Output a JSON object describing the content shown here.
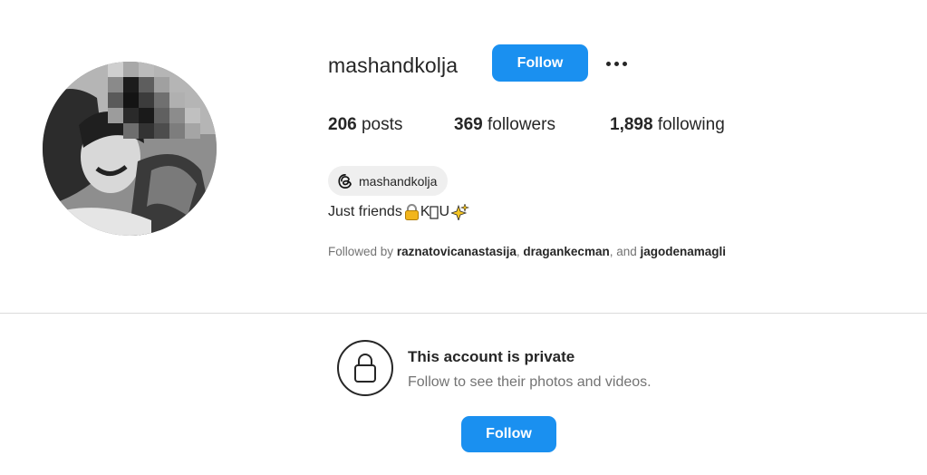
{
  "profile": {
    "username": "mashandkolja",
    "follow_label": "Follow",
    "more_icon": "more-horizontal-icon",
    "stats": {
      "posts_count": "206",
      "posts_label": "posts",
      "followers_count": "369",
      "followers_label": "followers",
      "following_count": "1,898",
      "following_label": "following"
    },
    "threads_handle": "mashandkolja",
    "threads_icon": "threads-icon",
    "bio_text": "Just friends",
    "bio_middle": "K",
    "bio_end": "U",
    "followed_by": {
      "prefix": "Followed by",
      "users": [
        "raznatovicanastasija",
        "dragankecman",
        "jagodenamagli"
      ],
      "separator": ", ",
      "and_text": ", and"
    }
  },
  "private_notice": {
    "icon": "lock-icon",
    "title": "This account is private",
    "subtitle": "Follow to see their photos and videos.",
    "follow_label": "Follow"
  },
  "colors": {
    "accent": "#1a90f0",
    "text_primary": "#262626",
    "text_secondary": "#737373",
    "divider": "#dbdbdb",
    "chip_bg": "#efefef"
  }
}
